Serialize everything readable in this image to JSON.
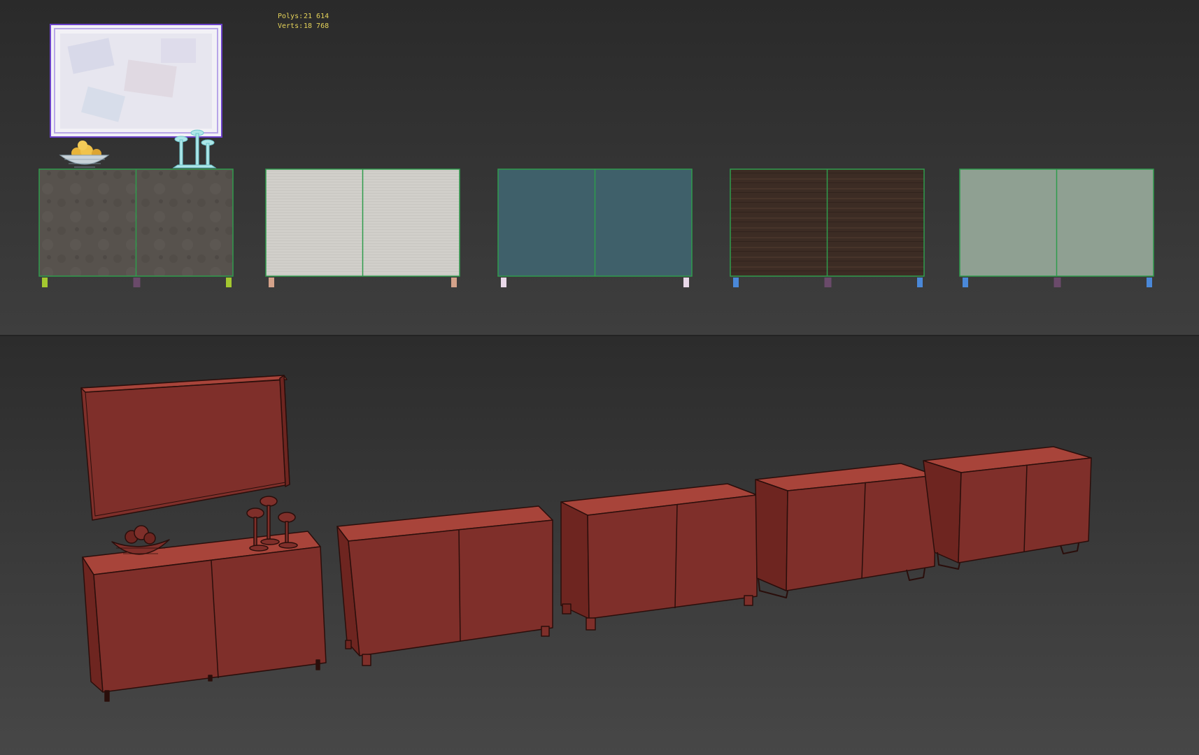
{
  "stats": {
    "polys_label": "Polys:",
    "polys_value": "21 614",
    "verts_label": "Verts:",
    "verts_value": "18 768"
  },
  "viewports": {
    "top": {
      "cabinet_materials": [
        "concrete",
        "white",
        "teal",
        "dark-wood",
        "sage-green"
      ],
      "colors": {
        "concrete": "#57524d",
        "white": "#d1cfca",
        "teal": "#3f606a",
        "dark-wood": "#3c2c24",
        "sage-green": "#8fa092",
        "selection_outline": "#2f9c4c",
        "frame_outline": "#6a40c8"
      }
    },
    "bottom": {
      "colors": {
        "mesh_fill": "#7f2f2a",
        "mesh_top": "#a8443a",
        "mesh_side": "#6e2520",
        "wire": "#2a0e0b"
      }
    }
  }
}
